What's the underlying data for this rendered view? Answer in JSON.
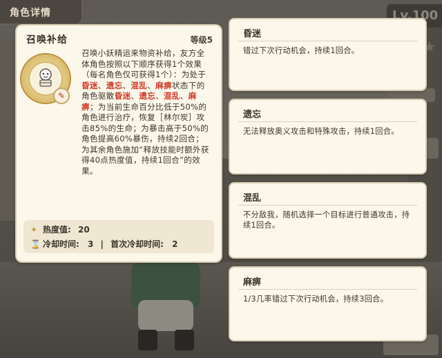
{
  "header": {
    "title": "角色详情",
    "level_badge": "Lv.100"
  },
  "skill": {
    "name": "召唤补给",
    "level": "等级5",
    "icon": "summon-supply-icon",
    "badge_icon": "wrench-icon",
    "description_parts": [
      {
        "t": "召唤小妖精运来物资补给，友方全体角色按照以下顺序获得1个效果（每名角色仅可获得1个）：为处于",
        "hl": false
      },
      {
        "t": "昏迷",
        "hl": true
      },
      {
        "t": "、",
        "hl": false
      },
      {
        "t": "遗忘",
        "hl": true
      },
      {
        "t": "、",
        "hl": false
      },
      {
        "t": "混乱",
        "hl": true
      },
      {
        "t": "、",
        "hl": false
      },
      {
        "t": "麻痹",
        "hl": true
      },
      {
        "t": "状态下的角色驱散",
        "hl": false
      },
      {
        "t": "昏迷",
        "hl": true
      },
      {
        "t": "、",
        "hl": false
      },
      {
        "t": "遗忘",
        "hl": true
      },
      {
        "t": "、",
        "hl": false
      },
      {
        "t": "混乱",
        "hl": true
      },
      {
        "t": "、",
        "hl": false
      },
      {
        "t": "麻痹",
        "hl": true
      },
      {
        "t": "；为当前生命百分比低于50%的角色进行治疗，恢复［林尔炭］攻击85%的生命；为暴击高于50%的角色提高60%暴伤，持续2回合；为其余角色施加“释放技能时额外获得40点热度值，持续1回合”的效果。",
        "hl": false
      }
    ],
    "heat_label": "热度值:",
    "heat_value": "20",
    "cooldown_label": "冷却时间:",
    "cooldown_value": "3",
    "first_cooldown_label": "首次冷却时间:",
    "first_cooldown_value": "2"
  },
  "statuses": [
    {
      "name": "昏迷",
      "desc": "错过下次行动机会，持续1回合。"
    },
    {
      "name": "遗忘",
      "desc": "无法释放奥义攻击和特殊攻击，持续1回合。"
    },
    {
      "name": "混乱",
      "desc": "不分敌我，随机选择一个目标进行普通攻击，持续1回合。"
    },
    {
      "name": "麻痹",
      "desc": "1/3几率错过下次行动机会，持续3回合。"
    }
  ],
  "colors": {
    "highlight": "#d03a2a",
    "card_bg": "#fbf7ea",
    "text": "#3d362d"
  }
}
